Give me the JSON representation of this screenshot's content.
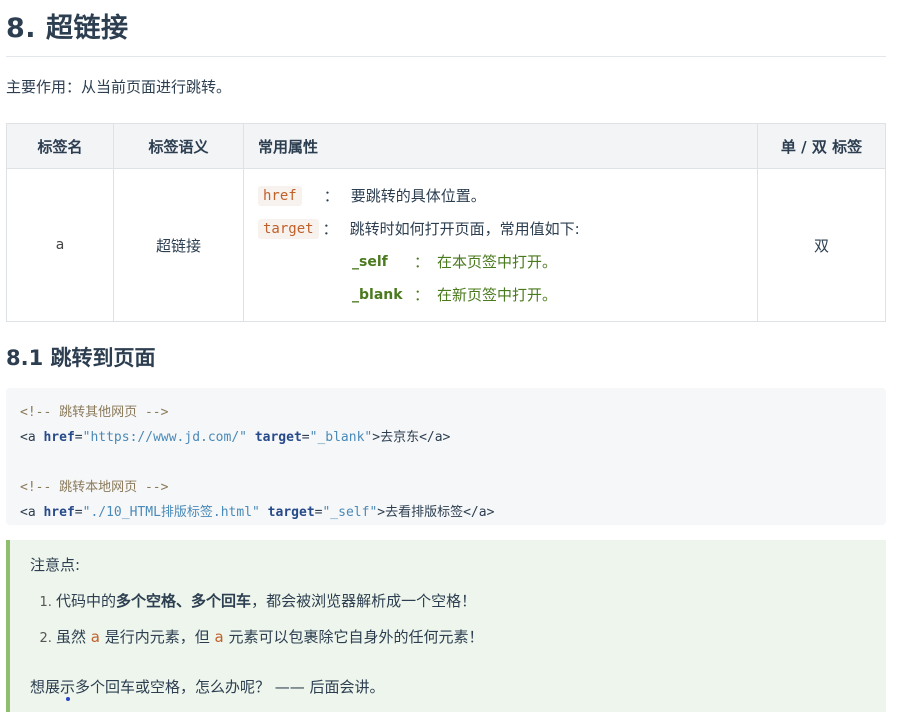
{
  "heading": "8. 超链接",
  "intro": "主要作用：从当前页面进行跳转。",
  "table": {
    "headers": [
      "标签名",
      "标签语义",
      "常用属性",
      "单 / 双 标签"
    ],
    "row": {
      "tag": "a",
      "semantic": "超链接",
      "attrs": {
        "href_name": "href",
        "href_colon": "：",
        "href_desc": "要跳转的具体位置。",
        "target_name": "target",
        "target_colon": "：",
        "target_desc": "跳转时如何打开页面，常用值如下:",
        "self_key": "_self",
        "self_colon": "：",
        "self_desc": "在本页签中打开。",
        "blank_key": "_blank",
        "blank_colon": "：",
        "blank_desc": "在新页签中打开。"
      },
      "type": "双"
    }
  },
  "section_heading": "8.1 跳转到页面",
  "code": {
    "comment1": "<!-- 跳转其他网页 -->",
    "line1": {
      "open": "<a ",
      "attr1": "href",
      "eq1": "=",
      "val1": "\"https://www.jd.com/\"",
      "attr2": " target",
      "eq2": "=",
      "val2": "\"_blank\"",
      "close": ">去京东</a>"
    },
    "comment2": "<!-- 跳转本地网页 -->",
    "line2": {
      "open": "<a ",
      "attr1": "href",
      "eq1": "=",
      "val1": "\"./10_HTML排版标签.html\"",
      "attr2": " target",
      "eq2": "=",
      "val2": "\"_self\"",
      "close": ">去看排版标签</a>"
    }
  },
  "note": {
    "title": "注意点:",
    "item1": {
      "pre": "代码中的",
      "b1": "多个空格",
      "sep": "、",
      "b2": "多个回车",
      "post": "，都会被浏览器解析成一个空格！"
    },
    "item2": {
      "pre": "虽然 ",
      "c1": "a",
      "mid1": " 是行内元素，但 ",
      "c2": "a",
      "post": " 元素可以包裹除它自身外的任何元素！"
    },
    "footer": "想展示多个回车或空格，怎么办呢？ —— 后面会讲。"
  },
  "colors": {
    "accent_green": "#4a7a1e",
    "code_orange": "#c0602a",
    "note_border": "#8fbf6e"
  }
}
